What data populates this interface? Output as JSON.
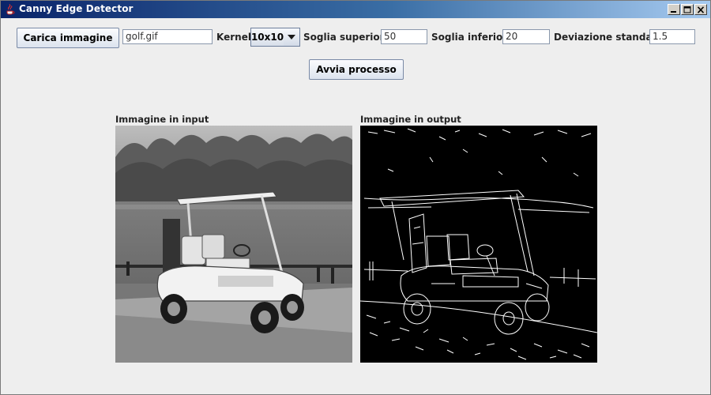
{
  "window": {
    "title": "Canny Edge Detector",
    "icon": "java-coffee-icon"
  },
  "controls": {
    "load_button": "Carica immagine",
    "file_value": "golf.gif",
    "kernel_label": "Kernel",
    "kernel_value": "10x10",
    "upper_label": "Soglia superiore",
    "upper_value": "50",
    "lower_label": "Soglia inferiore",
    "lower_value": "20",
    "stddev_label": "Deviazione standard",
    "stddev_value": "1.5",
    "run_button": "Avvia processo"
  },
  "panels": {
    "input_title": "Immagine in input",
    "output_title": "Immagine in output"
  },
  "colors": {
    "titlebar_start": "#0a246a",
    "titlebar_end": "#a6caf0",
    "window_bg": "#eeeeee",
    "output_bg": "#000000",
    "edge_color": "#ffffff"
  }
}
